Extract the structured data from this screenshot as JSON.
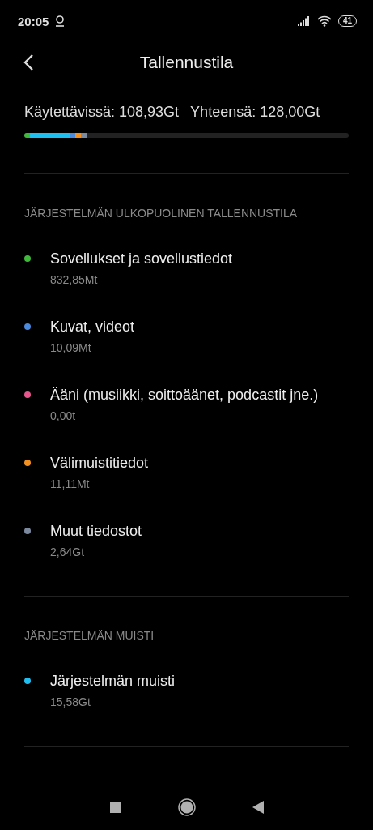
{
  "status_bar": {
    "time": "20:05",
    "battery": "41"
  },
  "header": {
    "title": "Tallennustila"
  },
  "summary": {
    "available": "Käytettävissä: 108,93Gt",
    "total": "Yhteensä: 128,00Gt",
    "segments": [
      {
        "color": "#3fb93a"
      },
      {
        "color": "#1ec0f2"
      },
      {
        "color": "#4a8be0"
      },
      {
        "color": "#f4901e"
      },
      {
        "color": "#7c8aa0"
      }
    ]
  },
  "sections": [
    {
      "title": "JÄRJESTELMÄN ULKOPUOLINEN TALLENNUSTILA",
      "items": [
        {
          "label": "Sovellukset ja sovellustiedot",
          "size": "832,85Mt",
          "color": "#3fb93a"
        },
        {
          "label": "Kuvat, videot",
          "size": "10,09Mt",
          "color": "#4a8be0"
        },
        {
          "label": "Ääni (musiikki, soittoäänet, podcastit jne.)",
          "size": "0,00t",
          "color": "#e8548c"
        },
        {
          "label": "Välimuistitiedot",
          "size": "11,11Mt",
          "color": "#f4901e"
        },
        {
          "label": "Muut tiedostot",
          "size": "2,64Gt",
          "color": "#7c8aa0"
        }
      ]
    },
    {
      "title": "JÄRJESTELMÄN MUISTI",
      "items": [
        {
          "label": "Järjestelmän muisti",
          "size": "15,58Gt",
          "color": "#1ec0f2"
        }
      ]
    }
  ]
}
